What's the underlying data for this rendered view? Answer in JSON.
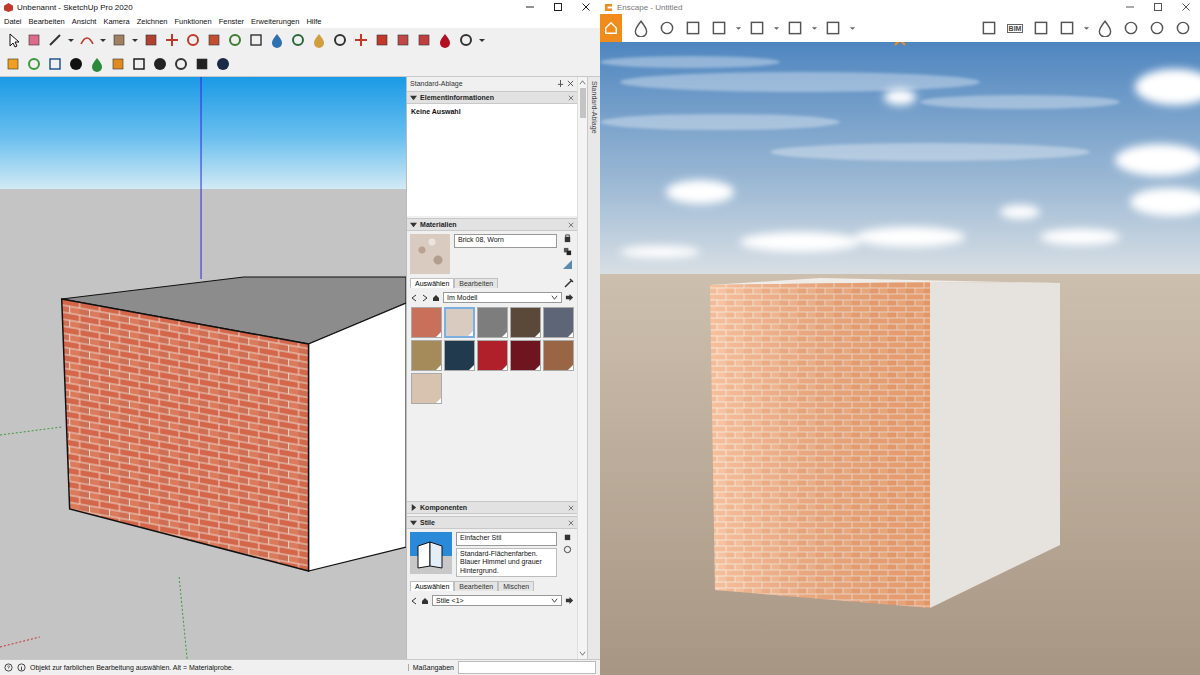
{
  "sketchup": {
    "title": "Unbenannt - SketchUp Pro 2020",
    "menu": [
      "Datei",
      "Bearbeiten",
      "Ansicht",
      "Kamera",
      "Zeichnen",
      "Funktionen",
      "Fenster",
      "Erweiterungen",
      "Hilfe"
    ],
    "tray": {
      "title": "Standard-Ablage",
      "side_tab": "Standard-Ablage",
      "entity_info": {
        "title": "Elementinformationen",
        "expanded": true,
        "text": "Keine Auswahl"
      },
      "materials": {
        "title": "Materialien",
        "expanded": true,
        "name": "Brick 08, Worn",
        "tabs": [
          {
            "label": "Auswählen",
            "selected": true
          },
          {
            "label": "Bearbeiten",
            "selected": false
          }
        ],
        "collection": "Im Modell",
        "swatches": [
          {
            "color": "#c8705a",
            "selected": false
          },
          {
            "color": "#d9cbbf",
            "selected": true
          },
          {
            "color": "#7d7d7d",
            "selected": false
          },
          {
            "color": "#5a4838",
            "selected": false
          },
          {
            "color": "#5d6577",
            "selected": false
          },
          {
            "color": "#a58a5a",
            "selected": false
          },
          {
            "color": "#223a4e",
            "selected": false
          },
          {
            "color": "#b0202a",
            "selected": false
          },
          {
            "color": "#6e1520",
            "selected": false
          },
          {
            "color": "#9a6545",
            "selected": false
          },
          {
            "color": "#d8c2b0",
            "selected": false
          }
        ]
      },
      "components": {
        "title": "Komponenten",
        "expanded": false
      },
      "styles": {
        "title": "Stile",
        "expanded": true,
        "name": "Einfacher Stil",
        "description": "Standard-Flächenfarben. Blauer Himmel und grauer Hintergrund.",
        "tabs": [
          {
            "label": "Auswählen",
            "selected": true
          },
          {
            "label": "Bearbeiten",
            "selected": false
          },
          {
            "label": "Mischen",
            "selected": false
          }
        ],
        "collection": "Stile <1>"
      }
    },
    "status_bar": {
      "message": "Objekt zur farblichen Bearbeitung auswählen. Alt = Materialprobe.",
      "measurements_label": "Maßangaben",
      "measurements_value": ""
    }
  },
  "enscape": {
    "title": "Enscape - Untitled",
    "bim_label": "BIM"
  }
}
